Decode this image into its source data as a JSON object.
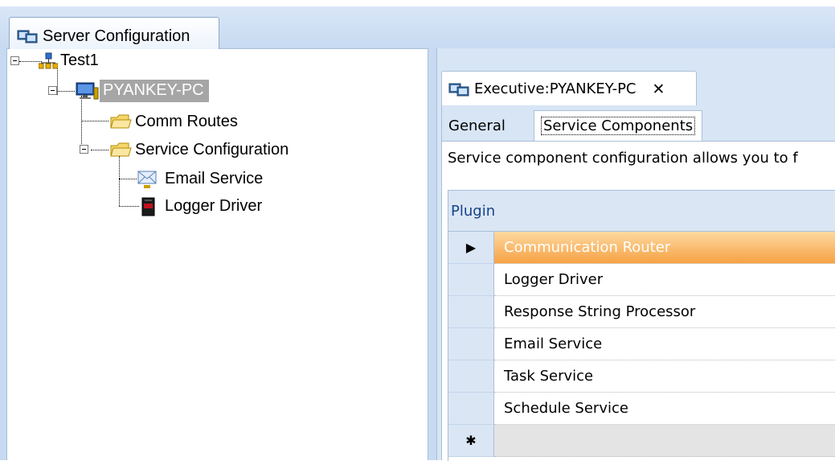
{
  "window": {
    "main_tab_label": "Server Configuration"
  },
  "tree": {
    "root": "Test1",
    "server": "PYANKEY-PC",
    "comm_routes": "Comm Routes",
    "service_configuration": "Service Configuration",
    "email_service": "Email Service",
    "logger_driver": "Logger Driver"
  },
  "document": {
    "tab_label": "Executive:PYANKEY-PC",
    "close_glyph": "✕",
    "subtabs": [
      "General",
      "Service Components"
    ],
    "description": "Service component configuration allows you to f",
    "grid": {
      "column_header": "Plugin",
      "rows": [
        "Communication Router",
        "Logger Driver",
        "Response String Processor",
        "Email Service",
        "Task Service",
        "Schedule Service"
      ],
      "selected_marker": "▶",
      "new_row_marker": "✱"
    }
  },
  "icons": {
    "network": "network-icon",
    "computer": "computer-icon",
    "folder": "folder-icon",
    "envelope": "envelope-icon",
    "logger": "logger-device-icon"
  },
  "colors": {
    "chrome_blue": "#c7daf1",
    "selection_orange": "#f7a244",
    "tree_selection_gray": "#a6a6a6"
  }
}
